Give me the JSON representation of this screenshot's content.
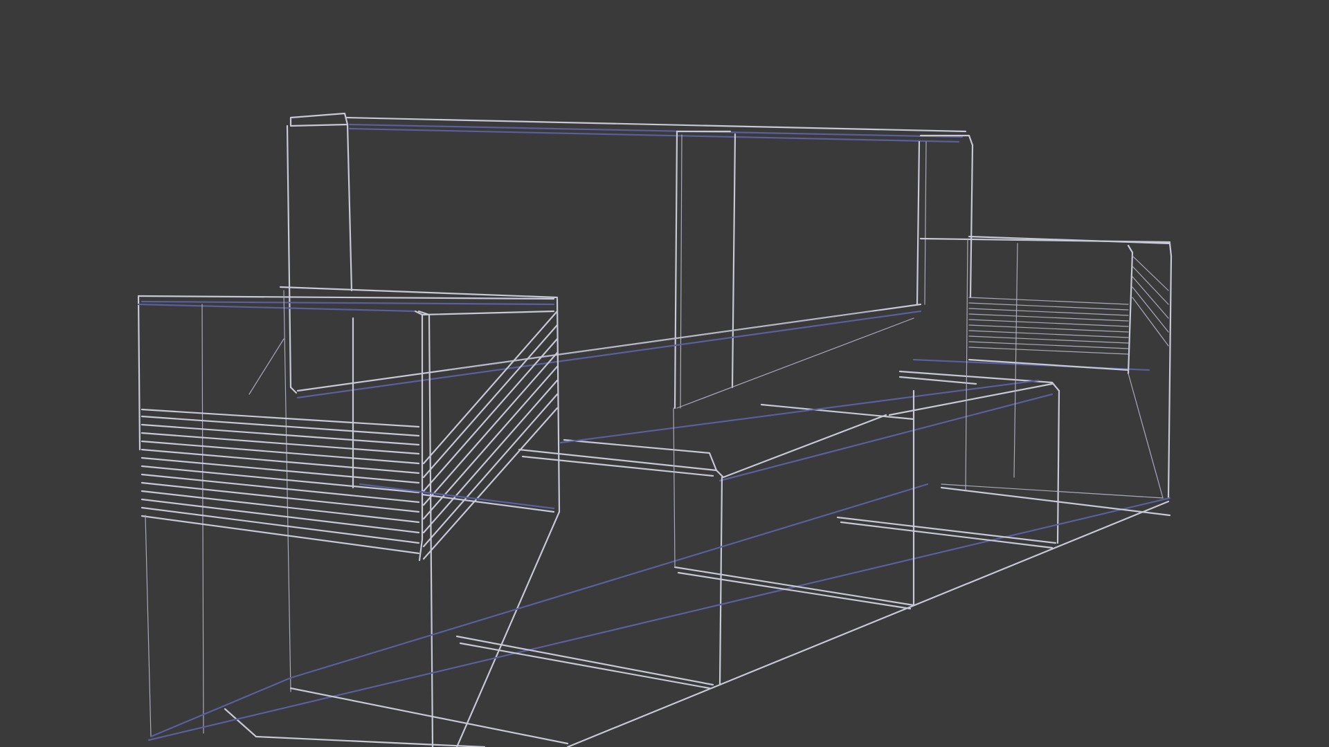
{
  "viewport": {
    "background_color": "#3a3a3a",
    "edge_color_light": "#c7c9d6",
    "edge_color_blue": "#5b5f9e",
    "display_mode": "wireframe"
  },
  "model": {
    "subject": "sofa",
    "parts": [
      "backrest",
      "left-armrest",
      "right-armrest",
      "seat-cushions",
      "base"
    ]
  }
}
